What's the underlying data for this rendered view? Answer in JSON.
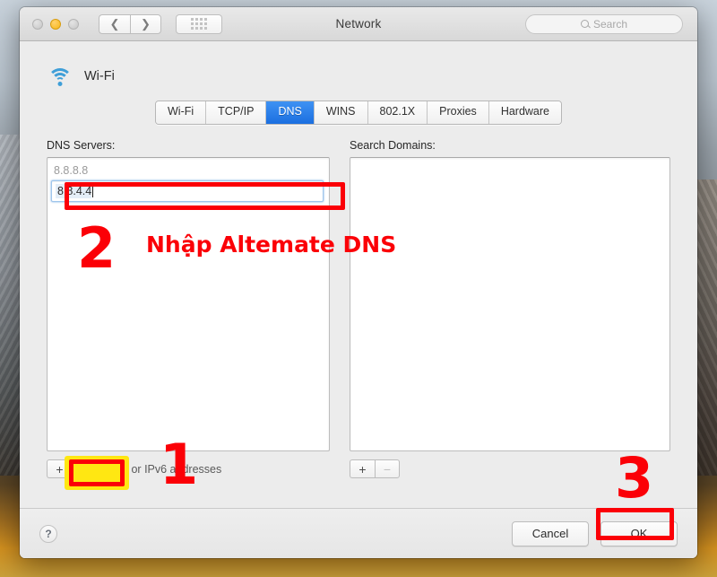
{
  "window": {
    "title": "Network",
    "traffic_lights": [
      "close",
      "minimize",
      "zoom"
    ],
    "nav_back_icon": "chevron-left-icon",
    "nav_forward_icon": "chevron-right-icon",
    "grid_icon": "show-all-grid-icon",
    "search": {
      "placeholder": "Search",
      "icon": "search-icon",
      "value": ""
    }
  },
  "service": {
    "icon": "wifi-icon",
    "name": "Wi-Fi"
  },
  "tabs": [
    {
      "label": "Wi-Fi",
      "active": false
    },
    {
      "label": "TCP/IP",
      "active": false
    },
    {
      "label": "DNS",
      "active": true
    },
    {
      "label": "WINS",
      "active": false
    },
    {
      "label": "802.1X",
      "active": false
    },
    {
      "label": "Proxies",
      "active": false
    },
    {
      "label": "Hardware",
      "active": false
    }
  ],
  "dns_panel": {
    "dns_servers": {
      "label": "DNS Servers:",
      "rows": [
        {
          "value": "8.8.8.8",
          "state": "inherited"
        }
      ],
      "editing_row": {
        "value": "8.8.4.4",
        "state": "editing"
      },
      "add_label": "+",
      "remove_label": "−",
      "add_icon": "plus-icon",
      "remove_icon": "minus-icon",
      "hint": "IPv4 or IPv6 addresses"
    },
    "search_domains": {
      "label": "Search Domains:",
      "rows": [],
      "add_label": "+",
      "remove_label": "−",
      "add_icon": "plus-icon",
      "remove_icon": "minus-icon",
      "remove_disabled": true
    }
  },
  "footer": {
    "help_label": "?",
    "help_icon": "help-icon",
    "cancel_label": "Cancel",
    "ok_label": "OK"
  },
  "annotations": {
    "accent_red": "#fb0007",
    "accent_yellow": "#ffe712",
    "step1_number": "1",
    "step2_number": "2",
    "step2_text": "Nhập Altemate DNS",
    "step3_number": "3"
  }
}
